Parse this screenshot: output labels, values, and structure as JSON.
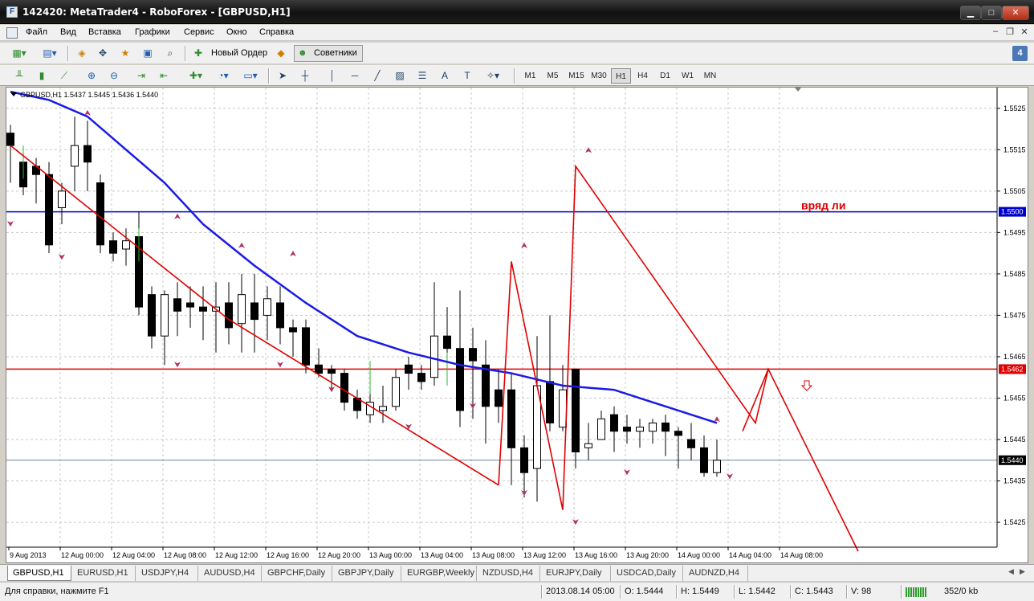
{
  "window": {
    "title": "142420: MetaTrader4 - RoboForex - [GBPUSD,H1]"
  },
  "menu": [
    "Файл",
    "Вид",
    "Вставка",
    "Графики",
    "Сервис",
    "Окно",
    "Справка"
  ],
  "toolbar": {
    "new_order": "Новый Ордер",
    "advisors": "Советники",
    "timeframes": [
      "M1",
      "M5",
      "M15",
      "M30",
      "H1",
      "H4",
      "D1",
      "W1",
      "MN"
    ],
    "active_timeframe": "H1",
    "alerts_badge": "4"
  },
  "chart": {
    "header": "GBPUSD,H1  1.5437 1.5445 1.5436 1.5440",
    "annotation": "вряд ли",
    "y_ticks": [
      "1.5525",
      "1.5515",
      "1.5505",
      "1.5495",
      "1.5485",
      "1.5475",
      "1.5465",
      "1.5455",
      "1.5445",
      "1.5435",
      "1.5425"
    ],
    "x_ticks": [
      "9 Aug 2013",
      "12 Aug 00:00",
      "12 Aug 04:00",
      "12 Aug 08:00",
      "12 Aug 12:00",
      "12 Aug 16:00",
      "12 Aug 20:00",
      "13 Aug 00:00",
      "13 Aug 04:00",
      "13 Aug 08:00",
      "13 Aug 12:00",
      "13 Aug 16:00",
      "13 Aug 20:00",
      "14 Aug 00:00",
      "14 Aug 04:00",
      "14 Aug 08:00"
    ],
    "price_labels": [
      {
        "value": "1.5500",
        "color": "#0000cc"
      },
      {
        "value": "1.5462",
        "color": "#e00000"
      },
      {
        "value": "1.5440",
        "color": "#000000"
      }
    ],
    "colors": {
      "blue_ma": "#1a1ae6",
      "red": "#e00000",
      "fractal": "#b03060",
      "green": "#2eb82e"
    }
  },
  "chart_data": {
    "type": "candlestick",
    "symbol": "GBPUSD",
    "timeframe": "H1",
    "ylim": [
      1.5419,
      1.553
    ],
    "horizontal_lines": [
      {
        "price": 1.55,
        "color": "#0000cc"
      },
      {
        "price": 1.5462,
        "color": "#e00000"
      },
      {
        "price": 1.544,
        "color": "#708090"
      }
    ],
    "candles": [
      [
        1.5519,
        1.5516,
        1.5521,
        1.5507
      ],
      [
        1.5512,
        1.5506,
        1.5512,
        1.5504
      ],
      [
        1.5511,
        1.5509,
        1.5513,
        1.5502
      ],
      [
        1.5509,
        1.5492,
        1.5512,
        1.549
      ],
      [
        1.5501,
        1.5505,
        1.5507,
        1.5497
      ],
      [
        1.5511,
        1.5516,
        1.5523,
        1.5505
      ],
      [
        1.5516,
        1.5512,
        1.5522,
        1.5505
      ],
      [
        1.5507,
        1.5492,
        1.5509,
        1.549
      ],
      [
        1.5493,
        1.549,
        1.5495,
        1.5488
      ],
      [
        1.5491,
        1.5493,
        1.5496,
        1.5487
      ],
      [
        1.5494,
        1.5477,
        1.55,
        1.5475
      ],
      [
        1.548,
        1.547,
        1.5482,
        1.5467
      ],
      [
        1.547,
        1.548,
        1.5481,
        1.5463
      ],
      [
        1.5479,
        1.5476,
        1.5483,
        1.547
      ],
      [
        1.5478,
        1.5477,
        1.5482,
        1.5472
      ],
      [
        1.5477,
        1.5476,
        1.5482,
        1.5469
      ],
      [
        1.5476,
        1.5477,
        1.5483,
        1.5466
      ],
      [
        1.5478,
        1.5472,
        1.5483,
        1.5468
      ],
      [
        1.5473,
        1.548,
        1.5485,
        1.5466
      ],
      [
        1.5478,
        1.5474,
        1.5485,
        1.5466
      ],
      [
        1.5475,
        1.5479,
        1.5482,
        1.5469
      ],
      [
        1.5478,
        1.5472,
        1.5482,
        1.5468
      ],
      [
        1.5472,
        1.5471,
        1.5474,
        1.5465
      ],
      [
        1.5472,
        1.5463,
        1.5474,
        1.5461
      ],
      [
        1.5463,
        1.5461,
        1.5467,
        1.546
      ],
      [
        1.5462,
        1.5461,
        1.5463,
        1.5457
      ],
      [
        1.5461,
        1.5454,
        1.5462,
        1.5452
      ],
      [
        1.5455,
        1.5452,
        1.5457,
        1.545
      ],
      [
        1.5451,
        1.5454,
        1.5457,
        1.5449
      ],
      [
        1.5452,
        1.5453,
        1.5458,
        1.5449
      ],
      [
        1.5453,
        1.546,
        1.5462,
        1.5452
      ],
      [
        1.5463,
        1.5461,
        1.5465,
        1.5457
      ],
      [
        1.5461,
        1.5459,
        1.5463,
        1.5457
      ],
      [
        1.546,
        1.547,
        1.5483,
        1.5458
      ],
      [
        1.547,
        1.5467,
        1.5477,
        1.5458
      ],
      [
        1.5467,
        1.5452,
        1.5481,
        1.5448
      ],
      [
        1.5467,
        1.5464,
        1.5472,
        1.545
      ],
      [
        1.5463,
        1.5453,
        1.5469,
        1.5444
      ],
      [
        1.5457,
        1.5453,
        1.5462,
        1.5449
      ],
      [
        1.5457,
        1.5443,
        1.5461,
        1.5434
      ],
      [
        1.5443,
        1.5437,
        1.5446,
        1.5431
      ],
      [
        1.5438,
        1.5458,
        1.547,
        1.543
      ],
      [
        1.5459,
        1.5449,
        1.5475,
        1.5447
      ],
      [
        1.5448,
        1.5457,
        1.5463,
        1.5447
      ],
      [
        1.5462,
        1.5442,
        1.5462,
        1.5438
      ],
      [
        1.5443,
        1.5444,
        1.5449,
        1.544
      ],
      [
        1.5445,
        1.545,
        1.5452,
        1.5445
      ],
      [
        1.5451,
        1.5447,
        1.5453,
        1.5442
      ],
      [
        1.5448,
        1.5447,
        1.5451,
        1.5444
      ],
      [
        1.5447,
        1.5448,
        1.545,
        1.5443
      ],
      [
        1.5447,
        1.5449,
        1.545,
        1.5444
      ],
      [
        1.5449,
        1.5447,
        1.5451,
        1.5441
      ],
      [
        1.5447,
        1.5446,
        1.5448,
        1.5438
      ],
      [
        1.5445,
        1.5443,
        1.5449,
        1.544
      ],
      [
        1.5443,
        1.5437,
        1.5446,
        1.5436
      ],
      [
        1.5437,
        1.544,
        1.5445,
        1.5436
      ]
    ],
    "moving_average": {
      "color": "#1a1ae6",
      "points": [
        [
          0,
          1.5529
        ],
        [
          3,
          1.5527
        ],
        [
          6,
          1.5523
        ],
        [
          9,
          1.5515
        ],
        [
          12,
          1.5507
        ],
        [
          15,
          1.5497
        ],
        [
          19,
          1.5487
        ],
        [
          23,
          1.5478
        ],
        [
          27,
          1.547
        ],
        [
          31,
          1.5466
        ],
        [
          35,
          1.5463
        ],
        [
          39,
          1.5461
        ],
        [
          43,
          1.5458
        ],
        [
          47,
          1.5457
        ],
        [
          50,
          1.5454
        ],
        [
          55,
          1.5449
        ]
      ]
    },
    "red_trendlines": [
      [
        [
          0,
          1.5516
        ],
        [
          17,
          1.5474
        ],
        [
          38,
          1.5434
        ]
      ],
      [
        [
          38,
          1.5434
        ],
        [
          39,
          1.5488
        ],
        [
          41,
          1.5458
        ],
        [
          43,
          1.5428
        ],
        [
          44,
          1.5511
        ],
        [
          58,
          1.5449
        ],
        [
          59,
          1.5462
        ],
        [
          66,
          1.5418
        ]
      ],
      [
        [
          57,
          1.5447
        ],
        [
          59,
          1.5462
        ]
      ]
    ]
  },
  "tabs": [
    "GBPUSD,H1",
    "EURUSD,H1",
    "USDJPY,H4",
    "AUDUSD,H4",
    "GBPCHF,Daily",
    "GBPJPY,Daily",
    "EURGBP,Weekly",
    "NZDUSD,H4",
    "EURJPY,Daily",
    "USDCAD,Daily",
    "AUDNZD,H4"
  ],
  "status": {
    "help": "Для справки, нажмите F1",
    "datetime": "2013.08.14 05:00",
    "open": "O: 1.5444",
    "high": "H: 1.5449",
    "low": "L: 1.5442",
    "close": "C: 1.5443",
    "volume": "V: 98",
    "traffic": "352/0 kb"
  }
}
